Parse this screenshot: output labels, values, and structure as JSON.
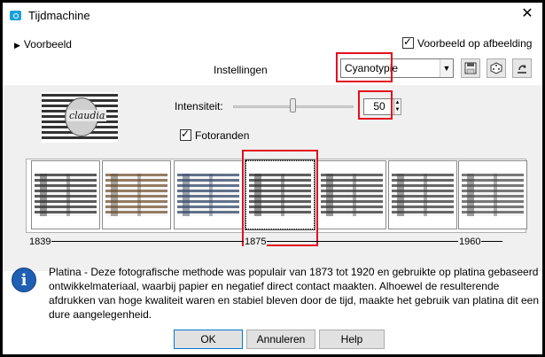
{
  "window": {
    "title": "Tijdmachine"
  },
  "header": {
    "preview_toggle_label": "Voorbeeld",
    "preview_on_image_label": "Voorbeeld op afbeelding",
    "preview_on_image_checked": true,
    "settings_label": "Instellingen",
    "preset_value": "Cyanotypie"
  },
  "controls": {
    "intensity_label": "Intensiteit:",
    "intensity_value": "50",
    "intensity_fraction": 0.5,
    "photo_edges_label": "Fotoranden",
    "photo_edges_checked": true,
    "thumbnail_text": "claudia"
  },
  "styles": {
    "cards": [
      {
        "name": "card-1",
        "tone": "#4a4a4a",
        "dark": "#222"
      },
      {
        "name": "card-2",
        "tone": "#8a6e52",
        "dark": "#4a3a2a"
      },
      {
        "name": "card-3",
        "tone": "#51627f",
        "dark": "#2b3a55"
      },
      {
        "name": "card-4",
        "tone": "#4d4d4d",
        "dark": "#1e1e1e",
        "selected": true
      },
      {
        "name": "card-5",
        "tone": "#555555",
        "dark": "#2a2a2a"
      },
      {
        "name": "card-6",
        "tone": "#585858",
        "dark": "#2d2d2d"
      },
      {
        "name": "card-7",
        "tone": "#6a6a6a",
        "dark": "#333"
      }
    ],
    "years": [
      "1839",
      "1875",
      "1960"
    ]
  },
  "info": {
    "description": "Platina - Deze fotografische methode was populair van 1873 tot 1920 en gebruikte op platina gebaseerd ontwikkelmateriaal, waarbij papier en negatief direct contact maakten. Alhoewel de resulterende afdrukken van hoge kwaliteit waren en stabiel bleven door de tijd, maakte het gebruik van platina dit een dure aangelegenheid."
  },
  "buttons": {
    "ok": "OK",
    "cancel": "Annuleren",
    "help": "Help"
  },
  "colors": {
    "highlight": "#e3101b",
    "info_icon": "#1f5fb4"
  }
}
